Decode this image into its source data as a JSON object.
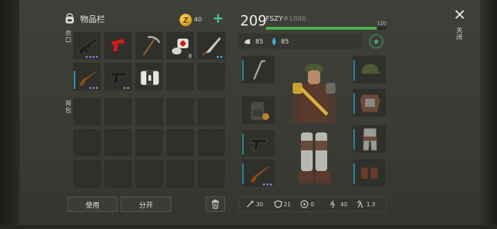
{
  "header": {
    "title": "物品栏",
    "bag_icon": "backpack-icon",
    "coins": "40",
    "coin_symbol": "Z",
    "add_label": "+"
  },
  "sections": {
    "pockets_label": "衣口",
    "backpack_label": "背包"
  },
  "pockets": [
    {
      "icon": "assault-rifle-icon",
      "quality_dots": 4
    },
    {
      "icon": "flare-gun-icon",
      "quality_dots": 0
    },
    {
      "icon": "pickaxe-icon",
      "quality_dots": 0
    },
    {
      "icon": "bandage-icon",
      "count": "8"
    },
    {
      "icon": "machete-icon",
      "quality_dots": 2
    },
    {
      "icon": "shotgun-icon",
      "quality_dots": 3
    },
    {
      "icon": "pistol-icon",
      "quality_dots": 2
    },
    {
      "icon": "first-aid-kit-icon",
      "quality_dots": 0
    },
    {
      "icon": "",
      "quality_dots": 0
    },
    {
      "icon": "",
      "quality_dots": 0
    }
  ],
  "actions": {
    "use_label": "使用",
    "split_label": "分开",
    "trash_icon": "trash-icon"
  },
  "player": {
    "level": "209",
    "name": "FSZY",
    "id": "#1886",
    "xp_max": "120",
    "xp_progress": 0.92,
    "food": "85",
    "water": "85"
  },
  "equipment": {
    "left": [
      "crowbar-icon",
      "backpack-icon",
      "pistol-icon",
      "shotgun-icon"
    ],
    "right": [
      "cap-icon",
      "armor-vest-icon",
      "pants-icon",
      "boots-icon"
    ]
  },
  "stats": [
    {
      "icon": "damage-icon",
      "value": "30"
    },
    {
      "icon": "armor-icon",
      "value": "21"
    },
    {
      "icon": "radiation-icon",
      "value": "0"
    },
    {
      "icon": "speed-icon",
      "value": "40"
    },
    {
      "icon": "stealth-icon",
      "value": "1.3"
    }
  ],
  "close": {
    "label": "关闭"
  },
  "colors": {
    "accent": "#46c9a0",
    "xp": "#46b34a",
    "slot": "#2f302b"
  }
}
